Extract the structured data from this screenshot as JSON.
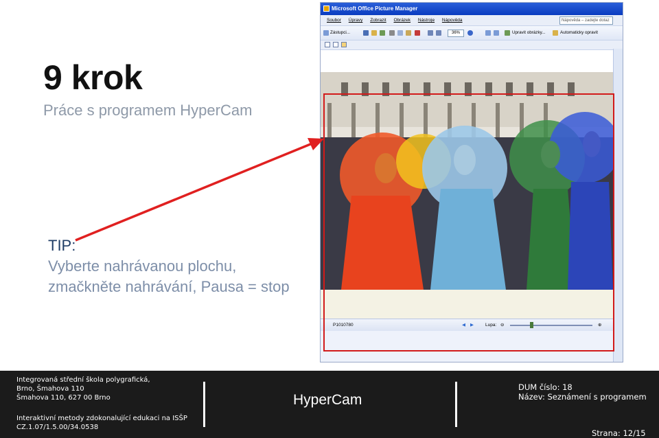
{
  "slide": {
    "title": "9 krok",
    "subtitle": "Práce s programem HyperCam",
    "tip_label": "TIP:",
    "tip_line1": "Vyberte nahrávanou plochu,",
    "tip_line2": "zmačkněte nahrávání, Pausa = stop"
  },
  "window": {
    "title": "Microsoft Office Picture Manager",
    "menu": [
      "Soubor",
      "Úpravy",
      "Zobrazit",
      "Obrázek",
      "Nástroje",
      "Nápověda"
    ],
    "help_placeholder": "Nápověda – zadejte dotaz",
    "toolbar": {
      "shortcuts": "Zástupci...",
      "zoom": "36%",
      "edit_pictures": "Upravit obrázky...",
      "auto_correct": "Automaticky opravit"
    },
    "status": {
      "filename": "P1010780",
      "zoom_label": "Lupa:"
    }
  },
  "footer": {
    "school_line1": "Integrovaná střední škola polygrafická,",
    "school_line2": "Brno, Šmahova 110",
    "school_line3": "Šmahova 110, 627 00 Brno",
    "project_line1": "Interaktivní metody zdokonalující edukaci na ISŠP",
    "project_line2": "CZ.1.07/1.5.00/34.0538",
    "center": "HyperCam",
    "dum": "DUM číslo: 18",
    "name": "Název: Seznámení s programem",
    "page": "Strana: 12/15"
  },
  "colors": {
    "selection": "#d21a1a",
    "footer_bg": "#1b1b1b",
    "tip_label": "#1f3d66",
    "tip_text": "#7d8ea8"
  }
}
